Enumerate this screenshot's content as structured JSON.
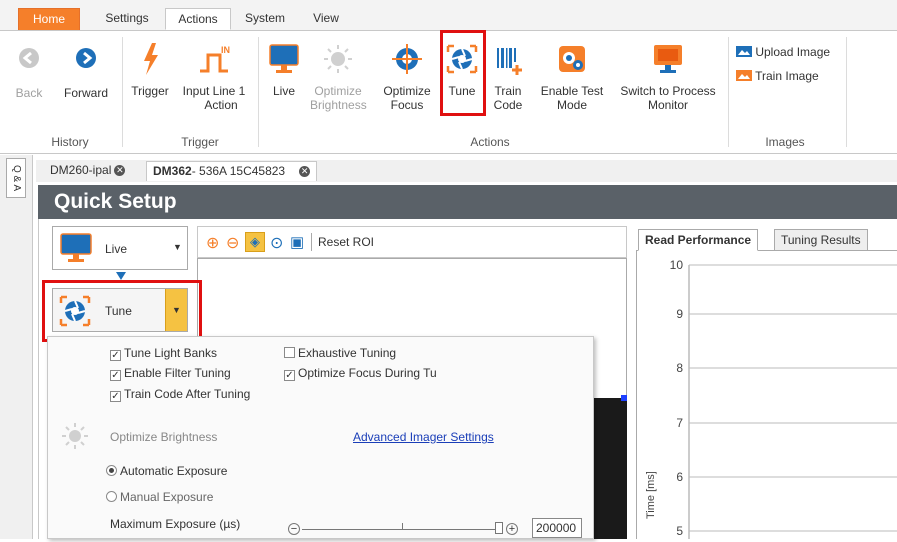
{
  "ribbon_tabs": [
    "Home",
    "Settings",
    "Actions",
    "System",
    "View"
  ],
  "ribbon": {
    "history": {
      "group": "History",
      "back": "Back",
      "forward": "Forward"
    },
    "trigger": {
      "group": "Trigger",
      "trigger": "Trigger",
      "input_line_1": "Input Line 1",
      "input_line_2": "Action"
    },
    "actions": {
      "group": "Actions",
      "live": "Live",
      "optimize_brightness_1": "Optimize",
      "optimize_brightness_2": "Brightness",
      "optimize_focus_1": "Optimize",
      "optimize_focus_2": "Focus",
      "tune": "Tune",
      "train_code_1": "Train",
      "train_code_2": "Code",
      "enable_test_1": "Enable Test",
      "enable_test_2": "Mode",
      "switch_1": "Switch to Process",
      "switch_2": "Monitor"
    },
    "images": {
      "group": "Images",
      "upload": "Upload Image",
      "train": "Train Image"
    }
  },
  "side_tab": "Q & A",
  "doc_tabs": {
    "tab1": "DM260-ipal",
    "tab2_bold": "DM362",
    "tab2_rest": "- 536A 15C45823"
  },
  "quick_setup": {
    "title": "Quick Setup",
    "live_combo": "Live",
    "tune_combo": "Tune",
    "reset_roi": "Reset ROI",
    "options": {
      "tune_light_banks": "Tune Light Banks",
      "enable_filter_tuning": "Enable Filter Tuning",
      "train_code_after": "Train Code After Tuning",
      "exhaustive_tuning": "Exhaustive Tuning",
      "optimize_focus_during": "Optimize Focus During Tu"
    },
    "optimize_brightness": "Optimize Brightness",
    "advanced_link": "Advanced Imager Settings",
    "automatic_exposure": "Automatic Exposure",
    "manual_exposure": "Manual Exposure",
    "max_exposure_label": "Maximum Exposure (µs)",
    "max_exposure_value": "200000"
  },
  "right_panel": {
    "tab_read": "Read Performance",
    "tab_tuning": "Tuning Results",
    "y_axis_label": "Time [ms]",
    "ticks": [
      "10",
      "9",
      "8",
      "7",
      "6",
      "5"
    ]
  },
  "colors": {
    "accent_orange": "#f57f2a",
    "highlight_red": "#e01010",
    "header_gray": "#5a6168",
    "icon_blue": "#1e6fb8"
  }
}
